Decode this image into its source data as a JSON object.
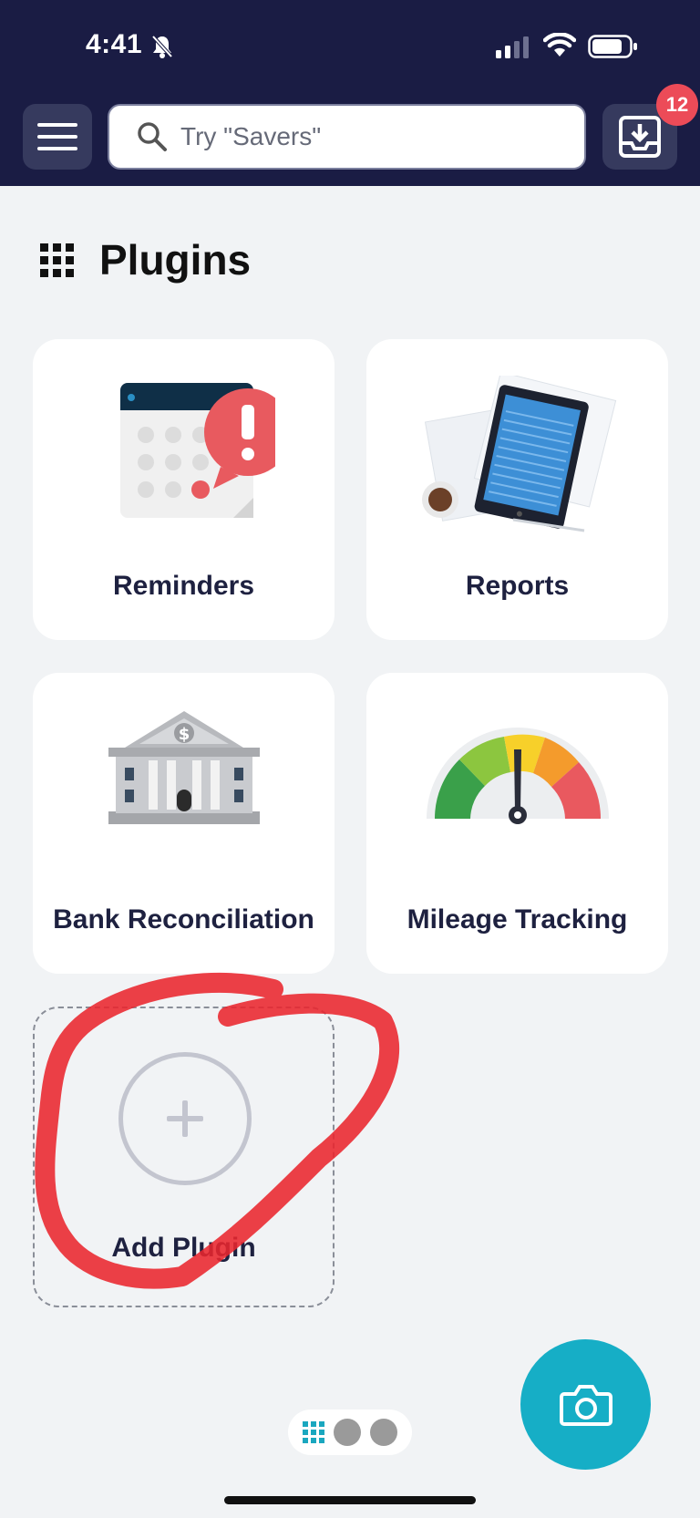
{
  "status_bar": {
    "time": "4:41"
  },
  "header": {
    "search_placeholder": "Try \"Savers\"",
    "inbox_badge": "12"
  },
  "page": {
    "title": "Plugins"
  },
  "plugins": [
    {
      "label": "Reminders"
    },
    {
      "label": "Reports"
    },
    {
      "label": "Bank Reconciliation"
    },
    {
      "label": "Mileage Tracking"
    }
  ],
  "add_plugin": {
    "label": "Add Plugin"
  },
  "colors": {
    "header": "#1a1c44",
    "accent": "#16aec6",
    "badge": "#ec4b58",
    "annotation": "#e9262e"
  }
}
